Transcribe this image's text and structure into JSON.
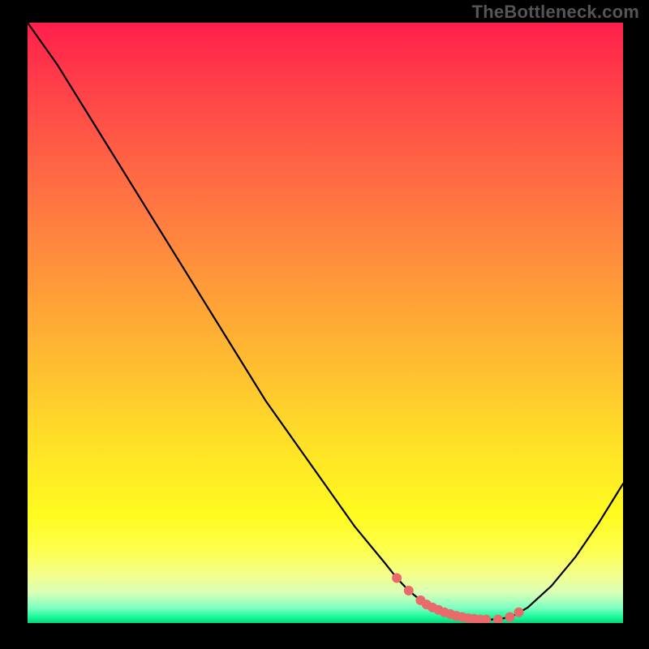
{
  "watermark": "TheBottleneck.com",
  "chart_data": {
    "type": "line",
    "title": "",
    "xlabel": "",
    "ylabel": "",
    "x_range": [
      0,
      100
    ],
    "y_range": [
      0,
      100
    ],
    "series": [
      {
        "name": "curve",
        "x": [
          0,
          5,
          10,
          15,
          20,
          25,
          30,
          35,
          40,
          45,
          50,
          55,
          60,
          62,
          64,
          66,
          68,
          70,
          72,
          74,
          76,
          78,
          80,
          82,
          84,
          88,
          92,
          96,
          100
        ],
        "y": [
          100,
          93,
          85,
          77,
          69,
          61,
          53,
          45,
          37,
          30,
          23,
          16,
          10,
          7.5,
          5.4,
          3.8,
          2.6,
          1.8,
          1.2,
          0.8,
          0.6,
          0.6,
          0.8,
          1.4,
          2.6,
          6.2,
          11.0,
          16.8,
          23.2
        ]
      }
    ],
    "markers": {
      "name": "highlight-dots",
      "x": [
        62,
        64,
        66,
        67,
        68,
        69,
        70,
        71,
        72,
        73,
        74,
        75,
        76,
        77,
        79,
        81,
        82.5
      ],
      "y": [
        7.5,
        5.4,
        3.8,
        3.1,
        2.6,
        2.2,
        1.8,
        1.5,
        1.2,
        1.0,
        0.8,
        0.7,
        0.6,
        0.6,
        0.6,
        1.0,
        1.8
      ],
      "color": "#ea6a6b",
      "radius": 6
    },
    "background_gradient": {
      "orientation": "vertical",
      "stops": [
        {
          "pos": 0.0,
          "color": "#ff1f4a"
        },
        {
          "pos": 0.22,
          "color": "#ff6045"
        },
        {
          "pos": 0.46,
          "color": "#ffa038"
        },
        {
          "pos": 0.7,
          "color": "#ffe028"
        },
        {
          "pos": 0.88,
          "color": "#fdff4e"
        },
        {
          "pos": 0.97,
          "color": "#7dffc0"
        },
        {
          "pos": 1.0,
          "color": "#08d67a"
        }
      ]
    }
  }
}
